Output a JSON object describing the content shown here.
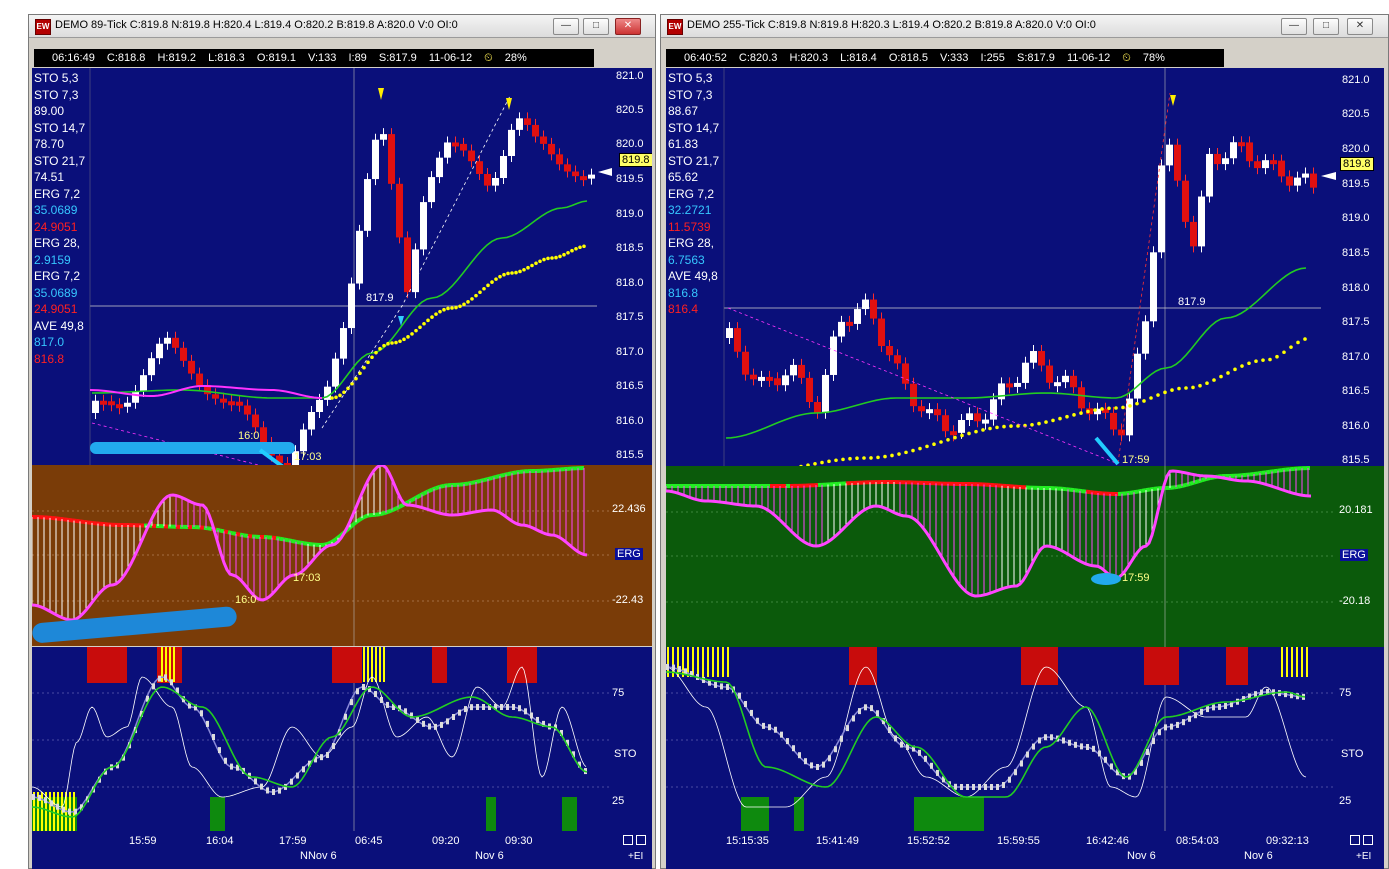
{
  "left": {
    "title": "DEMO 89-Tick C:819.8 N:819.8 H:820.4 L:819.4 O:820.2 B:819.8 A:820.0 V:0 OI:0",
    "info": [
      "06:16:49",
      "C:818.8",
      "H:819.2",
      "L:818.3",
      "O:819.1",
      "V:133",
      "I:89",
      "S:817.9",
      "11-06-12"
    ],
    "pct": "28%",
    "legend": [
      {
        "label": "STO  5,3",
        "v": ""
      },
      {
        "label": "STO  7,3",
        "v": "89.00"
      },
      {
        "label": "STO  14,7",
        "v": "78.70"
      },
      {
        "label": "STO  21,7",
        "v": "74.51"
      },
      {
        "label": "ERG  7,2",
        "v": "35.0689",
        "v2": "24.9051"
      },
      {
        "label": "ERG  28,",
        "v": "2.9159"
      },
      {
        "label": "ERG  7,2",
        "v": "35.0689",
        "v2": "24.9051"
      },
      {
        "label": "AVE  49,8",
        "v": "817.0",
        "v2": "816.8"
      }
    ],
    "price_axis": [
      "821.0",
      "820.5",
      "820.0",
      "819.5",
      "819.0",
      "818.5",
      "818.0",
      "817.5",
      "817.0",
      "816.5",
      "816.0",
      "815.5"
    ],
    "last": "819.8",
    "annot": [
      "817.9",
      "16:0",
      "17:03",
      "16:0",
      "17:03"
    ],
    "erg_axis": [
      "22.436",
      "ERG",
      "-22.43"
    ],
    "sto_axis": [
      "75",
      "STO",
      "25"
    ],
    "time_labels": [
      "15:59",
      "16:04",
      "17:59",
      "06:45",
      "09:20",
      "09:30"
    ],
    "date_labels": [
      "NNov 6",
      "Nov 6"
    ],
    "ei": "+EI"
  },
  "right": {
    "title": "DEMO 255-Tick C:819.8 N:819.8 H:820.3 L:819.4 O:820.2 B:819.8 A:820.0 V:0 OI:0",
    "info": [
      "06:40:52",
      "C:820.3",
      "H:820.3",
      "L:818.4",
      "O:818.5",
      "V:333",
      "I:255",
      "S:817.9",
      "11-06-12"
    ],
    "pct": "78%",
    "legend": [
      {
        "label": "STO  5,3",
        "v": ""
      },
      {
        "label": "STO  7,3",
        "v": "88.67"
      },
      {
        "label": "STO  14,7",
        "v": "61.83"
      },
      {
        "label": "STO  21,7",
        "v": "65.62"
      },
      {
        "label": "ERG  7,2",
        "v": "32.2721",
        "v2": "11.5739"
      },
      {
        "label": "ERG  28,",
        "v": "6.7563"
      },
      {
        "label": "AVE  49,8",
        "v": "816.8",
        "v2": "816.4"
      }
    ],
    "price_axis": [
      "821.0",
      "820.5",
      "820.0",
      "819.5",
      "819.0",
      "818.5",
      "818.0",
      "817.5",
      "817.0",
      "816.5",
      "816.0",
      "815.5"
    ],
    "last": "819.8",
    "annot": [
      "817.9",
      "17:59",
      "17:59"
    ],
    "erg_axis": [
      "20.181",
      "ERG",
      "-20.18"
    ],
    "sto_axis": [
      "75",
      "STO",
      "25"
    ],
    "time_labels": [
      "15:15:35",
      "15:41:49",
      "15:52:52",
      "15:59:55",
      "16:42:46",
      "08:54:03",
      "09:32:13"
    ],
    "date_labels": [
      "Nov 6",
      "Nov 6"
    ],
    "ei": "+EI"
  },
  "colors": {
    "chart_bg": "#0a0f7a",
    "erg_bg_left": "#7a3c08",
    "erg_bg_right": "#0b5a0b",
    "up": "#ffffff",
    "down": "#e01010",
    "sma": "#22cc22",
    "dots": "#ffff00"
  }
}
